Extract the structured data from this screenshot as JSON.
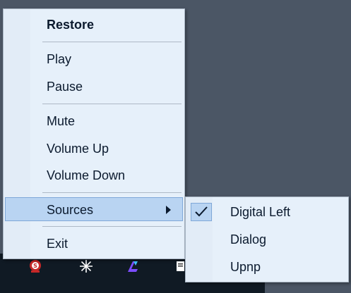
{
  "menu": {
    "items": [
      {
        "label": "Restore"
      },
      {
        "label": "Play"
      },
      {
        "label": "Pause"
      },
      {
        "label": "Mute"
      },
      {
        "label": "Volume Up"
      },
      {
        "label": "Volume Down"
      },
      {
        "label": "Sources"
      },
      {
        "label": "Exit"
      }
    ]
  },
  "submenu": {
    "items": [
      {
        "label": "Digital Left",
        "checked": true
      },
      {
        "label": "Dialog",
        "checked": false
      },
      {
        "label": "Upnp",
        "checked": false
      }
    ]
  },
  "tray": {
    "icons": [
      "red-badge-icon",
      "white-burst-icon",
      "purple-arrow-icon",
      "document-icon"
    ]
  },
  "colors": {
    "menu_background": "#e6f0fa",
    "highlight": "#b9d4f2",
    "desktop": "#4b5665",
    "taskbar": "#101a24"
  }
}
